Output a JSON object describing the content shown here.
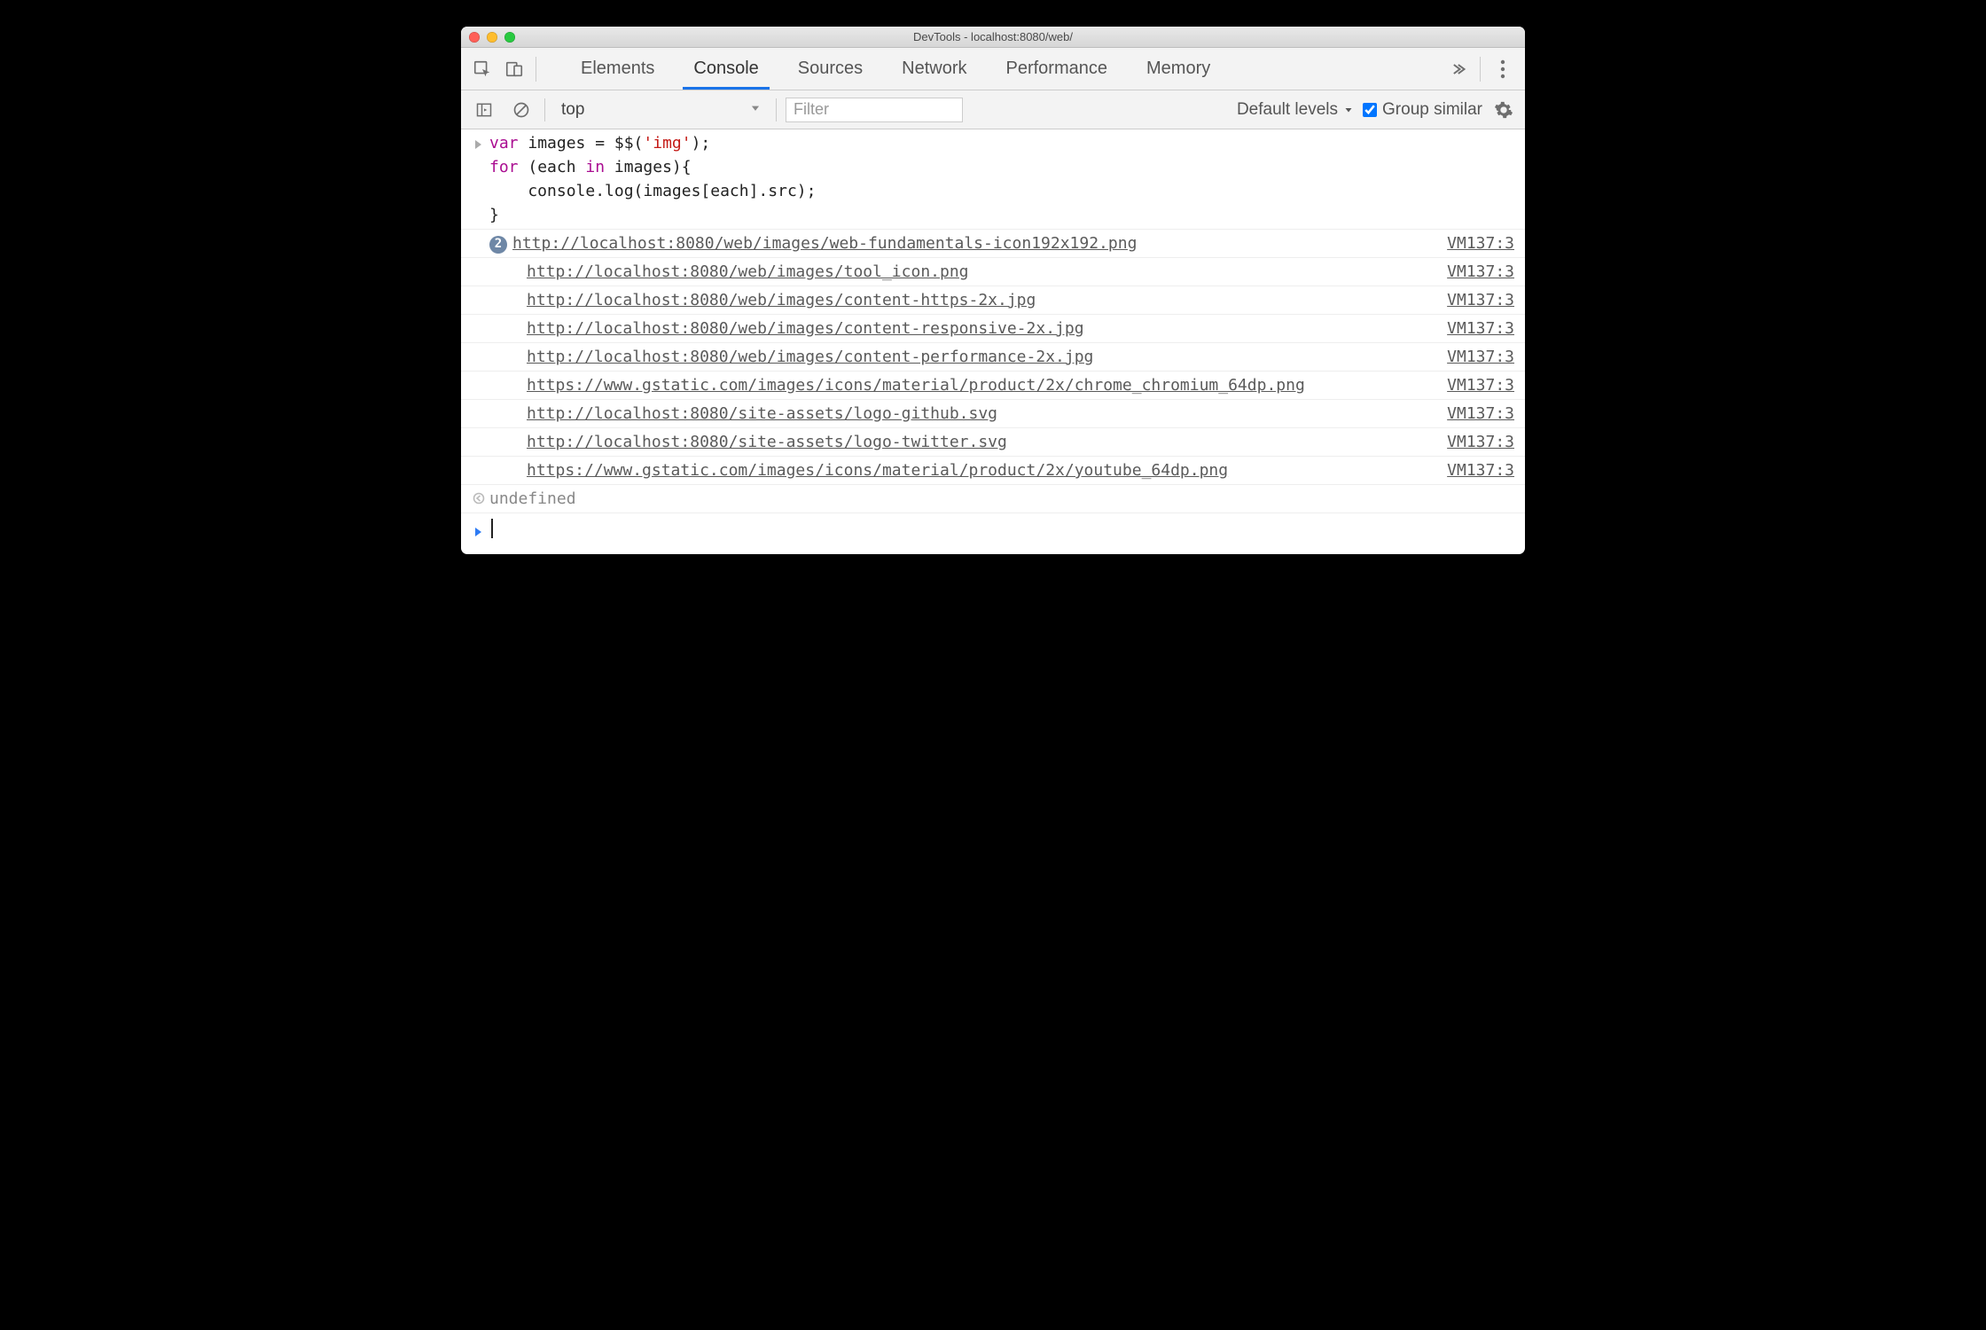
{
  "window": {
    "title": "DevTools - localhost:8080/web/"
  },
  "tabs": {
    "items": [
      "Elements",
      "Console",
      "Sources",
      "Network",
      "Performance",
      "Memory"
    ],
    "activeIndex": 1
  },
  "toolbar": {
    "context": "top",
    "filterPlaceholder": "Filter",
    "levelsLabel": "Default levels",
    "groupSimilar": {
      "label": "Group similar",
      "checked": true
    }
  },
  "input": {
    "line1_pre": "var",
    "line1_mid": " images = $$(",
    "line1_str": "'img'",
    "line1_post": ");",
    "line2_pre": "for",
    "line2_mid": " (each ",
    "line2_kw2": "in",
    "line2_post": " images){",
    "line3": "    console.log(images[each].src);",
    "line4": "}"
  },
  "logs": [
    {
      "badge": "2",
      "url": "http://localhost:8080/web/images/web-fundamentals-icon192x192.png",
      "src": "VM137:3"
    },
    {
      "url": "http://localhost:8080/web/images/tool_icon.png",
      "src": "VM137:3"
    },
    {
      "url": "http://localhost:8080/web/images/content-https-2x.jpg",
      "src": "VM137:3"
    },
    {
      "url": "http://localhost:8080/web/images/content-responsive-2x.jpg",
      "src": "VM137:3"
    },
    {
      "url": "http://localhost:8080/web/images/content-performance-2x.jpg",
      "src": "VM137:3"
    },
    {
      "url": "https://www.gstatic.com/images/icons/material/product/2x/chrome_chromium_64dp.png",
      "src": "VM137:3"
    },
    {
      "url": "http://localhost:8080/site-assets/logo-github.svg",
      "src": "VM137:3"
    },
    {
      "url": "http://localhost:8080/site-assets/logo-twitter.svg",
      "src": "VM137:3"
    },
    {
      "url": "https://www.gstatic.com/images/icons/material/product/2x/youtube_64dp.png",
      "src": "VM137:3"
    }
  ],
  "result": {
    "value": "undefined"
  }
}
